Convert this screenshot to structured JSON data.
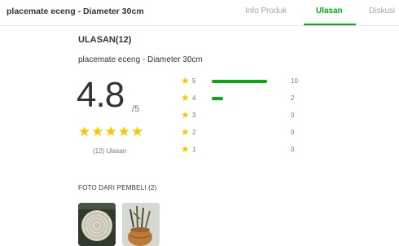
{
  "header": {
    "product_title": "placemate eceng - Diameter 30cm",
    "tabs": [
      {
        "label": "Info Produk",
        "active": false
      },
      {
        "label": "Ulasan",
        "active": true
      },
      {
        "label": "Diskusi",
        "active": false
      }
    ]
  },
  "reviews": {
    "section_title": "ULASAN(12)",
    "product_name": "placemate eceng - Diameter 30cm",
    "rating": "4.8",
    "rating_max": "/5",
    "stars_filled": 5,
    "review_count_text": "(12) Ulasan",
    "distribution": [
      {
        "stars": "5",
        "count": "10",
        "fraction": 0.76
      },
      {
        "stars": "4",
        "count": "2",
        "fraction": 0.16
      },
      {
        "stars": "3",
        "count": "0",
        "fraction": 0
      },
      {
        "stars": "2",
        "count": "0",
        "fraction": 0
      },
      {
        "stars": "1",
        "count": "0",
        "fraction": 0
      }
    ]
  },
  "photos": {
    "title": "FOTO DARI PEMBELI (2)",
    "items": [
      {
        "name": "round woven placemat photo"
      },
      {
        "name": "woven basket with stems photo"
      }
    ]
  },
  "colors": {
    "accent": "#03ac0e",
    "star": "#ffc400",
    "text": "#31353b",
    "muted": "#6d7588"
  }
}
